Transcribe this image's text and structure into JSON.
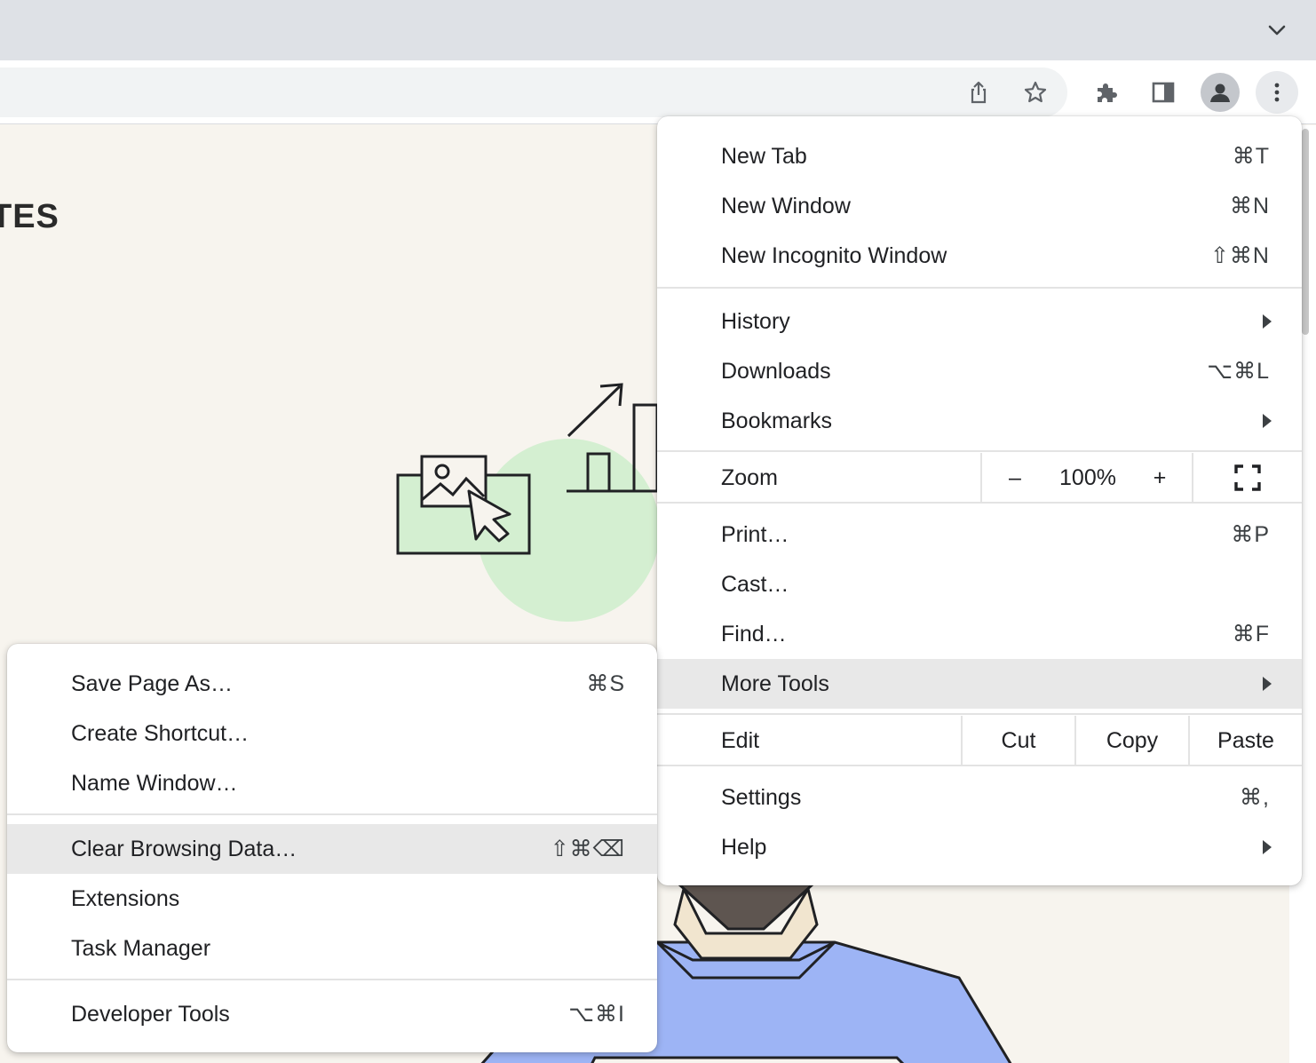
{
  "page": {
    "heading_fragment": "TES"
  },
  "main_menu": {
    "items": [
      {
        "label": "New Tab",
        "shortcut": "⌘T"
      },
      {
        "label": "New Window",
        "shortcut": "⌘N"
      },
      {
        "label": "New Incognito Window",
        "shortcut": "⇧⌘N"
      },
      {
        "label": "History"
      },
      {
        "label": "Downloads",
        "shortcut": "⌥⌘L"
      },
      {
        "label": "Bookmarks"
      },
      {
        "label": "Print…",
        "shortcut": "⌘P"
      },
      {
        "label": "Cast…"
      },
      {
        "label": "Find…",
        "shortcut": "⌘F"
      },
      {
        "label": "More Tools"
      },
      {
        "label": "Settings",
        "shortcut": "⌘,"
      },
      {
        "label": "Help"
      }
    ],
    "zoom": {
      "label": "Zoom",
      "minus": "–",
      "value": "100%",
      "plus": "+"
    },
    "edit": {
      "label": "Edit",
      "cut": "Cut",
      "copy": "Copy",
      "paste": "Paste"
    }
  },
  "more_tools_menu": {
    "items": [
      {
        "label": "Save Page As…",
        "shortcut": "⌘S"
      },
      {
        "label": "Create Shortcut…"
      },
      {
        "label": "Name Window…"
      },
      {
        "label": "Clear Browsing Data…",
        "shortcut": "⇧⌘⌫"
      },
      {
        "label": "Extensions"
      },
      {
        "label": "Task Manager"
      },
      {
        "label": "Developer Tools",
        "shortcut": "⌥⌘I"
      }
    ]
  },
  "colors": {
    "highlight": "#e8e8e8",
    "illustration_green": "#d4efd1",
    "person_blue": "#9db4f5"
  },
  "icons": [
    "chevron-down-icon",
    "share-icon",
    "star-icon",
    "puzzle-icon",
    "side-panel-icon",
    "profile-icon",
    "kebab-menu-icon",
    "fullscreen-icon"
  ]
}
